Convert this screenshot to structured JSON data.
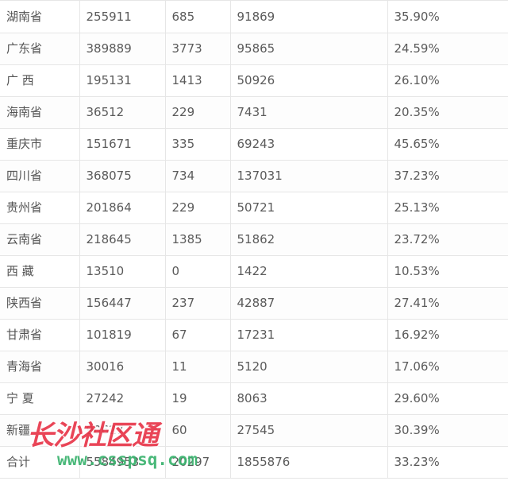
{
  "table": {
    "rows": [
      {
        "region": "湖南省",
        "c1": "255911",
        "c2": "685",
        "c3": "91869",
        "c4": "35.90%"
      },
      {
        "region": "广东省",
        "c1": "389889",
        "c2": "3773",
        "c3": "95865",
        "c4": "24.59%"
      },
      {
        "region": "广 西",
        "c1": "195131",
        "c2": "1413",
        "c3": "50926",
        "c4": "26.10%"
      },
      {
        "region": "海南省",
        "c1": "36512",
        "c2": "229",
        "c3": "7431",
        "c4": "20.35%"
      },
      {
        "region": "重庆市",
        "c1": "151671",
        "c2": "335",
        "c3": "69243",
        "c4": "45.65%"
      },
      {
        "region": "四川省",
        "c1": "368075",
        "c2": "734",
        "c3": "137031",
        "c4": "37.23%"
      },
      {
        "region": "贵州省",
        "c1": "201864",
        "c2": "229",
        "c3": "50721",
        "c4": "25.13%"
      },
      {
        "region": "云南省",
        "c1": "218645",
        "c2": "1385",
        "c3": "51862",
        "c4": "23.72%"
      },
      {
        "region": "西 藏",
        "c1": "13510",
        "c2": "0",
        "c3": "1422",
        "c4": "10.53%"
      },
      {
        "region": "陕西省",
        "c1": "156447",
        "c2": "237",
        "c3": "42887",
        "c4": "27.41%"
      },
      {
        "region": "甘肃省",
        "c1": "101819",
        "c2": "67",
        "c3": "17231",
        "c4": "16.92%"
      },
      {
        "region": "青海省",
        "c1": "30016",
        "c2": "11",
        "c3": "5120",
        "c4": "17.06%"
      },
      {
        "region": "宁 夏",
        "c1": "27242",
        "c2": "19",
        "c3": "8063",
        "c4": "29.60%"
      },
      {
        "region": "新疆",
        "c1": "90627",
        "c2": "60",
        "c3": "27545",
        "c4": "30.39%"
      },
      {
        "region": "合计",
        "c1": "5584953",
        "c2": "20297",
        "c3": "1855876",
        "c4": "33.23%"
      }
    ]
  },
  "watermark": {
    "title": "长沙社区通",
    "url": "www.csspsq.com",
    "title_color": "#e8364a",
    "url_color": "#3ab36e"
  }
}
